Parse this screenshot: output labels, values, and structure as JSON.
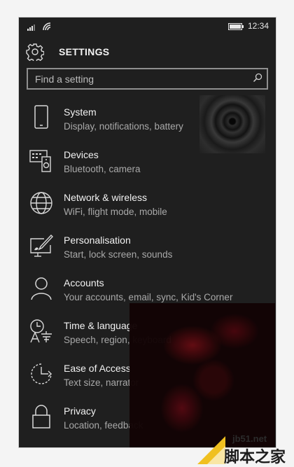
{
  "status": {
    "time": "12:34"
  },
  "header": {
    "title": "SETTINGS",
    "icon": "gear-icon"
  },
  "search": {
    "placeholder": "Find a setting",
    "icon": "search-icon"
  },
  "items": [
    {
      "label": "System",
      "sub": "Display, notifications, battery",
      "icon": "phone-icon"
    },
    {
      "label": "Devices",
      "sub": "Bluetooth, camera",
      "icon": "devices-icon"
    },
    {
      "label": "Network & wireless",
      "sub": "WiFi, flight mode, mobile",
      "icon": "globe-icon"
    },
    {
      "label": "Personalisation",
      "sub": "Start, lock screen, sounds",
      "icon": "paint-icon"
    },
    {
      "label": "Accounts",
      "sub": "Your accounts, email, sync, Kid's Corner",
      "icon": "person-icon"
    },
    {
      "label": "Time & language",
      "sub": "Speech, region, keyboard",
      "icon": "time-language-icon"
    },
    {
      "label": "Ease of Access",
      "sub": "Text size, narrator",
      "icon": "ease-of-access-icon"
    },
    {
      "label": "Privacy",
      "sub": "Location, feedback",
      "icon": "lock-icon"
    }
  ],
  "watermark": {
    "site": "jb51.net",
    "cn": "脚本之家"
  },
  "colors": {
    "background": "#1f1f1f",
    "text": "#f2f2f2",
    "subtext": "#a9a9a9"
  }
}
